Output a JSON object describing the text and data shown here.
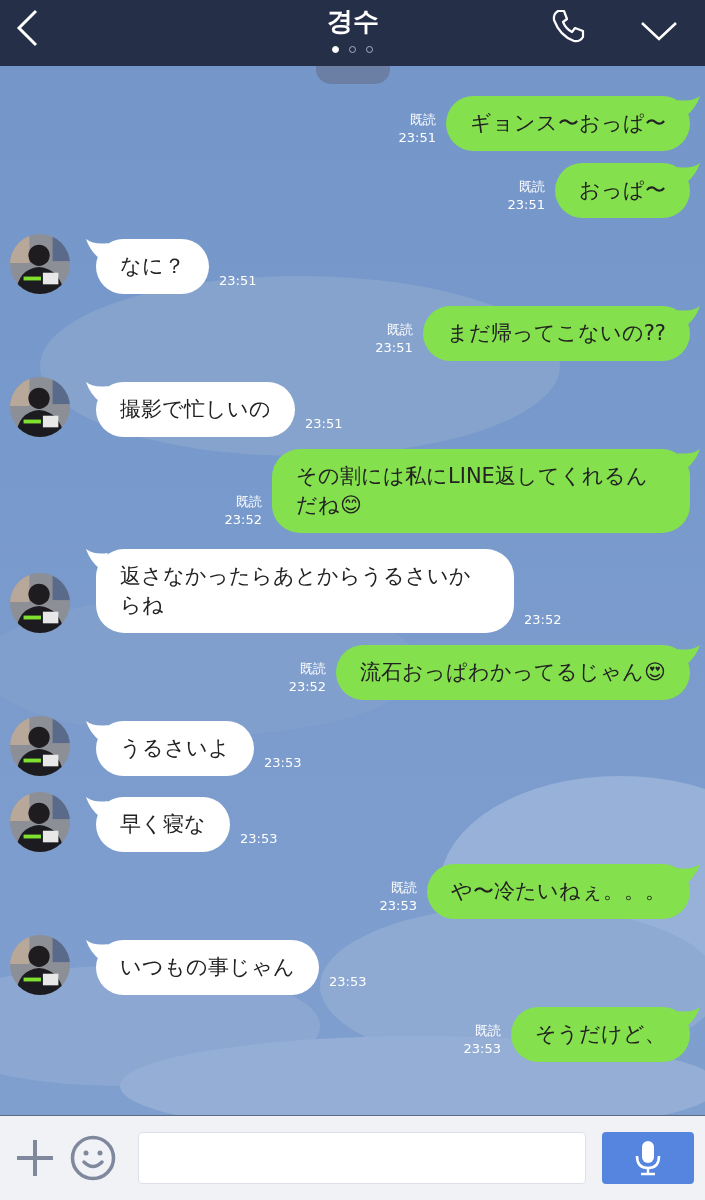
{
  "header": {
    "title": "경수",
    "page_dots": [
      {
        "selected": true
      },
      {
        "selected": false
      },
      {
        "selected": false
      }
    ]
  },
  "messages": [
    {
      "kind": "sent",
      "text": "ギョンス〜おっぱ〜",
      "read": "既読",
      "time": "23:51"
    },
    {
      "kind": "sent",
      "text": "おっぱ〜",
      "read": "既読",
      "time": "23:51"
    },
    {
      "kind": "received",
      "text": "なに？",
      "time": "23:51"
    },
    {
      "kind": "sent",
      "text": "まだ帰ってこないの??",
      "read": "既読",
      "time": "23:51"
    },
    {
      "kind": "received",
      "text": "撮影で忙しいの",
      "time": "23:51"
    },
    {
      "kind": "sent",
      "text": "その割には私にLINE返してくれるんだね😊",
      "read": "既読",
      "time": "23:52"
    },
    {
      "kind": "received",
      "text": "返さなかったらあとからうるさいからね",
      "time": "23:52"
    },
    {
      "kind": "sent",
      "text": "流石おっぱわかってるじゃん😍",
      "read": "既読",
      "time": "23:52"
    },
    {
      "kind": "received",
      "text": "うるさいよ",
      "time": "23:53"
    },
    {
      "kind": "received",
      "text": "早く寝な",
      "time": "23:53"
    },
    {
      "kind": "sent",
      "text": "や〜冷たいねぇ。。。",
      "read": "既読",
      "time": "23:53"
    },
    {
      "kind": "received",
      "text": "いつもの事じゃん",
      "time": "23:53"
    },
    {
      "kind": "sent",
      "text": "そうだけど、",
      "read": "既読",
      "time": "23:53"
    }
  ]
}
